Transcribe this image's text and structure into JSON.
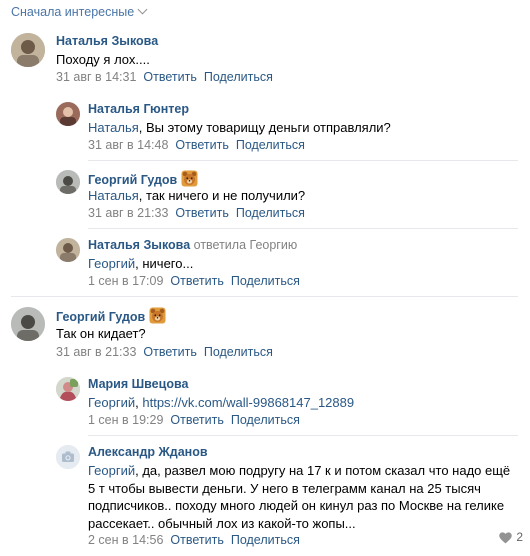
{
  "sort_label": "Сначала интересные",
  "actions": {
    "reply": "Ответить",
    "share": "Поделиться"
  },
  "comments": [
    {
      "author": "Наталья Зыкова",
      "text": "Походу я лох....",
      "date": "31 авг в 14:31"
    },
    {
      "author": "Наталья Гюнтер",
      "mention": "Наталья",
      "text": ", Вы этому товарищу деньги отправляли?",
      "date": "31 авг в 14:48"
    },
    {
      "author": "Георгий Гудов",
      "mention": "Наталья",
      "text": ", так ничего и не получили?",
      "date": "31 авг в 21:33"
    },
    {
      "author": "Наталья Зыкова",
      "reply_to": "ответила Георгию",
      "mention": "Георгий",
      "text": ", ничего...",
      "date": "1 сен в 17:09"
    },
    {
      "author": "Георгий Гудов",
      "text": "Так он кидает?",
      "date": "31 авг в 21:33"
    },
    {
      "author": "Мария Швецова",
      "mention": "Георгий",
      "text": ", ",
      "link": "https://vk.com/wall-99868147_12889",
      "date": "1 сен в 19:29"
    },
    {
      "author": "Александр Жданов",
      "mention": "Георгий",
      "text_lines": [
        ", да, развел мою подругу на 17 к и потом сказал что надо ещё",
        "5 т чтобы вывести деньги. У него в телеграмм канал на 25 тысяч",
        "подписчиков.. походу много людей он кинул раз по Москве на гелике",
        "рассекает.. обычный лох из какой-то жопы..."
      ],
      "date": "2 сен в 14:56",
      "likes": "2"
    }
  ],
  "icons": {
    "bear": "bear-emoji-icon",
    "camera": "camera-icon",
    "heart": "heart-icon",
    "chevron": "chevron-down-icon"
  },
  "colors": {
    "link": "#2a5885",
    "meta": "#828282",
    "divider": "#e7e8ec"
  }
}
